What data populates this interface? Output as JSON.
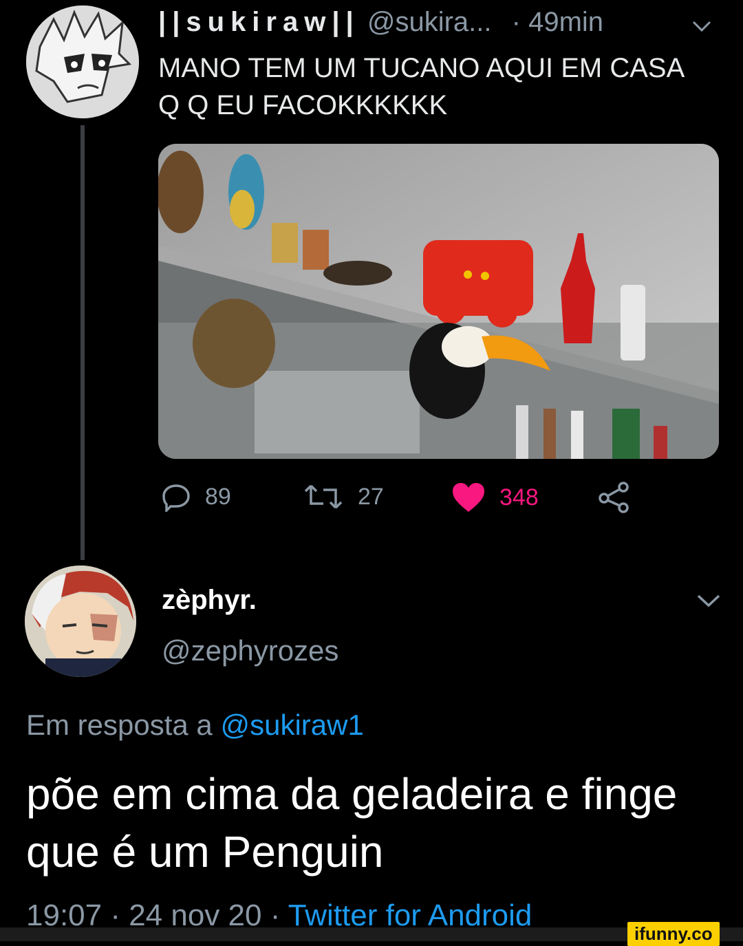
{
  "tweet": {
    "display_name": "||sukiraw||",
    "handle": "@sukira...",
    "time": "· 49min",
    "text": "MANO TEM UM TUCANO AQUI EM CASA Q Q EU FACOKKKKKK",
    "media_label": "kitchen shelf with toucan",
    "stats": {
      "replies": "89",
      "retweets": "27",
      "likes": "348"
    }
  },
  "reply": {
    "display_name": "zèphyr.",
    "handle": "@zephyrozes",
    "reply_prefix": "Em resposta a",
    "reply_mention": "@sukiraw1",
    "text": "põe em cima da geladeira e finge que é um Penguin",
    "timestamp": "19:07 · 24 nov 20 ·",
    "source": "Twitter for Android"
  },
  "watermark": "ifunny.co",
  "colors": {
    "background": "#000000",
    "muted": "#8b98a5",
    "link": "#1d9bf0",
    "like": "#f91880"
  }
}
